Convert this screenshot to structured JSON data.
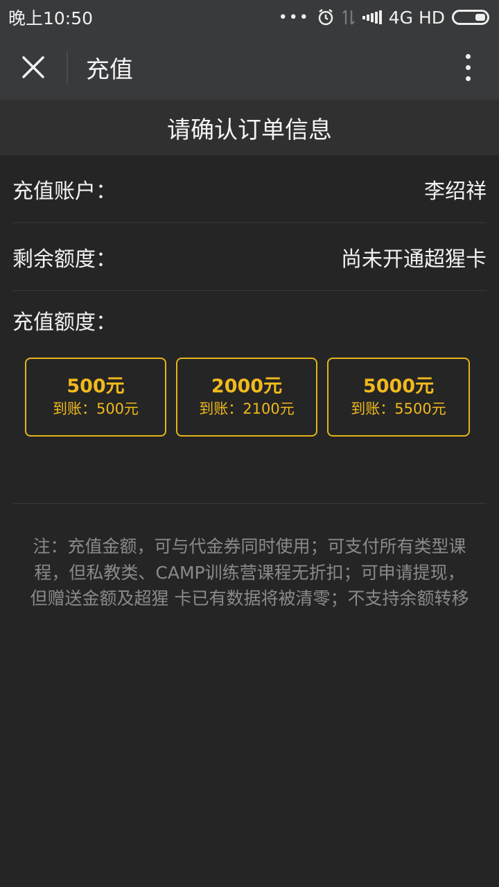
{
  "status_bar": {
    "time": "晚上10:50",
    "network": "4G HD"
  },
  "nav": {
    "title": "充值"
  },
  "header": {
    "title": "请确认订单信息"
  },
  "account": {
    "label": "充值账户：",
    "value": "李绍祥"
  },
  "balance": {
    "label": "剩余额度：",
    "value": "尚未开通超猩卡"
  },
  "amount": {
    "label": "充值额度："
  },
  "options": [
    {
      "amount": "500元",
      "credit": "到账：500元"
    },
    {
      "amount": "2000元",
      "credit": "到账：2100元"
    },
    {
      "amount": "5000元",
      "credit": "到账：5500元"
    }
  ],
  "note": "注：充值金额，可与代金券同时使用；可支付所有类型课程，但私教类、CAMP训练营课程无折扣；可申请提现，但赠送金额及超猩 卡已有数据将被清零；不支持余额转移",
  "colors": {
    "accent": "#f0b91c",
    "background": "#252525",
    "bar": "#393a3c"
  }
}
